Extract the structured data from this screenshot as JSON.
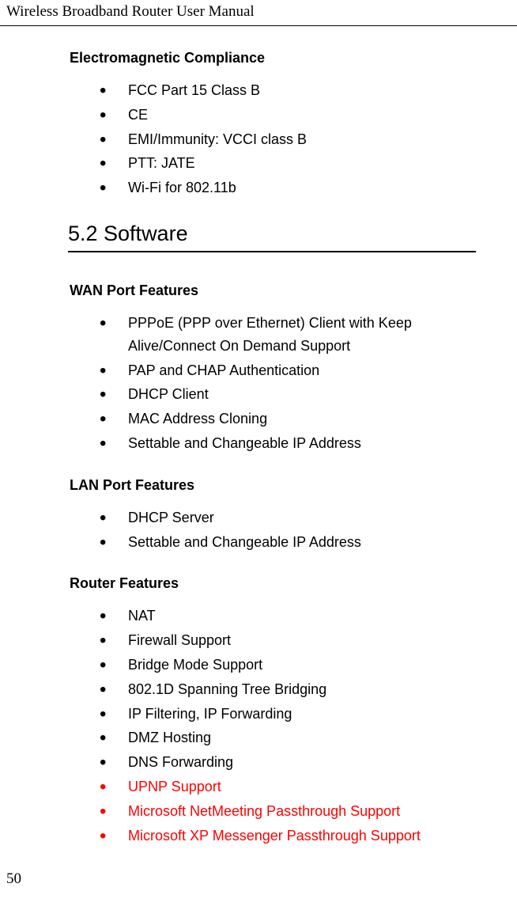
{
  "header": {
    "title": "Wireless Broadband Router User Manual"
  },
  "sections": {
    "emc": {
      "heading": "Electromagnetic Compliance",
      "items": [
        "FCC Part 15 Class B",
        "CE",
        "EMI/Immunity: VCCI class B",
        "PTT: JATE",
        "Wi-Fi for 802.11b"
      ]
    },
    "software": {
      "heading": "5.2 Software"
    },
    "wan": {
      "heading": "WAN Port Features",
      "items": [
        "PPPoE (PPP over Ethernet) Client with Keep Alive/Connect On Demand Support",
        "PAP and CHAP Authentication",
        "DHCP Client",
        "MAC Address Cloning",
        "Settable and Changeable IP Address"
      ]
    },
    "lan": {
      "heading": "LAN Port Features",
      "items": [
        "DHCP Server",
        "Settable and Changeable IP Address"
      ]
    },
    "router": {
      "heading": "Router Features",
      "items": [
        "NAT",
        "Firewall Support",
        "Bridge Mode Support",
        "802.1D Spanning Tree Bridging",
        "IP Filtering, IP Forwarding",
        "DMZ Hosting",
        "DNS Forwarding"
      ],
      "items_red": [
        "UPNP Support",
        "Microsoft NetMeeting Passthrough Support",
        "Microsoft XP Messenger Passthrough Support"
      ]
    }
  },
  "page_number": "50"
}
